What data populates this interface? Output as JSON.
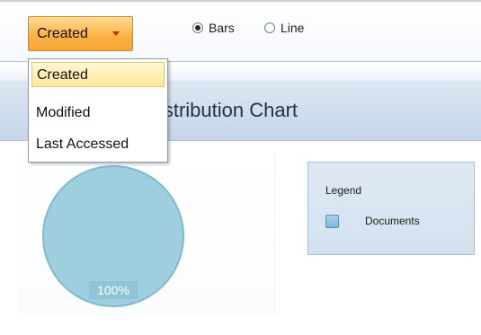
{
  "toolbar": {
    "sort_button": {
      "label": "Created",
      "icon": "chevron-down-icon"
    },
    "view_mode": {
      "options": [
        {
          "label": "Bars",
          "checked": true
        },
        {
          "label": "Line",
          "checked": false
        }
      ]
    }
  },
  "dropdown": {
    "items": [
      {
        "label": "Created",
        "selected": true
      },
      {
        "label": "Modified",
        "selected": false
      },
      {
        "label": "Last Accessed",
        "selected": false
      }
    ]
  },
  "chart": {
    "title": "s Distribution Chart",
    "legend_title": "Legend"
  },
  "chart_data": {
    "type": "pie",
    "series": [
      {
        "name": "Documents",
        "values": [
          100
        ]
      }
    ],
    "slices": [
      {
        "label": "Documents",
        "value": 100,
        "percent_label": "100%"
      }
    ],
    "legend_title": "Legend",
    "legend_position": "right",
    "colors": {
      "slice": "#9fcfdf",
      "slice_stroke": "#7fb8cf",
      "label_bg": "#8fc3d6"
    }
  },
  "colors": {
    "accent": "#fdb347",
    "title_band": "#cddbea",
    "selected_item": "#ffe89a"
  }
}
